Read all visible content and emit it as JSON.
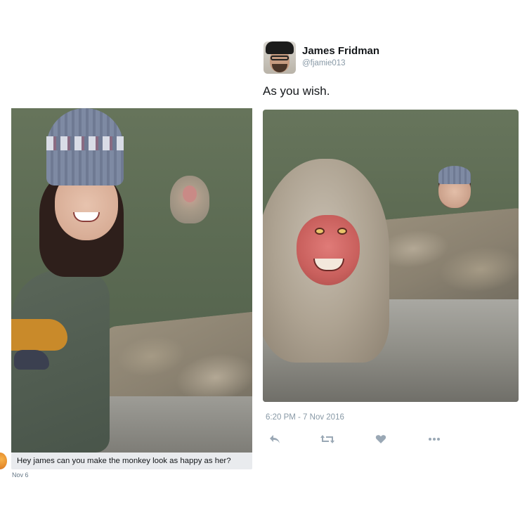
{
  "left_post": {
    "caption": "Hey james can you make the monkey look as happy as her?",
    "date": "Nov 6"
  },
  "tweet": {
    "author_name": "James Fridman",
    "author_handle": "@fjamie013",
    "text": "As you wish.",
    "timestamp": "6:20 PM - 7 Nov 2016",
    "actions": {
      "reply_icon": "reply-icon",
      "retweet_icon": "retweet-icon",
      "like_icon": "heart-icon",
      "more_icon": "more-icon"
    },
    "icon_color": "#9aa8b5"
  }
}
